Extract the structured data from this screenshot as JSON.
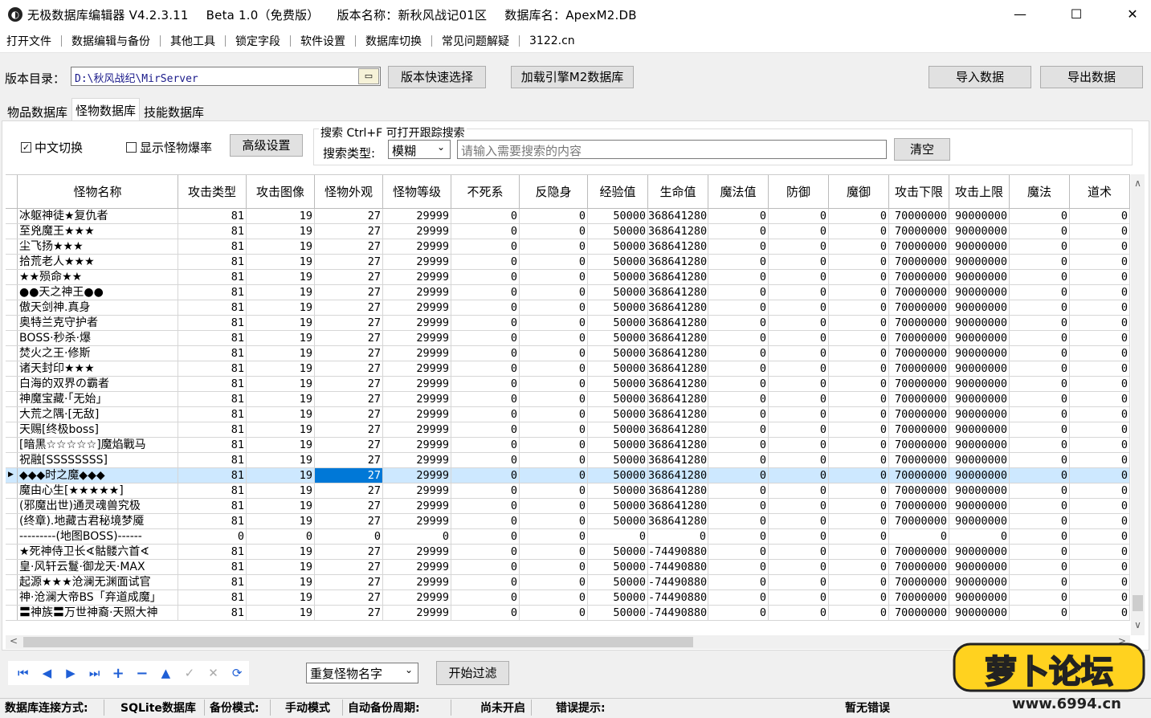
{
  "titlebar": {
    "app": "无极数据库编辑器 V4.2.3.11",
    "edition": "Beta 1.0（免费版）",
    "version_name": "版本名称：新秋风战记01区",
    "db_name": "数据库名：ApexM2.DB",
    "minimize": "—",
    "maximize": "☐",
    "close": "✕"
  },
  "menu": [
    "打开文件",
    "数据编辑与备份",
    "其他工具",
    "锁定字段",
    "软件设置",
    "数据库切换",
    "常见问题解疑",
    "3122.cn"
  ],
  "path": {
    "label": "版本目录：",
    "value": "D:\\秋风战纪\\MirServer",
    "quick_select": "版本快速选择",
    "load_engine": "加载引擎M2数据库",
    "import": "导入数据",
    "export": "导出数据"
  },
  "tabs": [
    "物品数据库",
    "怪物数据库",
    "技能数据库"
  ],
  "options": {
    "chinese_toggle": "中文切换",
    "chinese_checked": true,
    "show_drop": "显示怪物爆率",
    "show_drop_checked": false,
    "advanced": "高级设置"
  },
  "search": {
    "title": "搜索  Ctrl+F 可打开跟踪搜索",
    "type_label": "搜索类型:",
    "type_value": "模糊",
    "placeholder": "请输入需要搜索的内容",
    "clear": "清空"
  },
  "grid": {
    "columns": [
      "怪物名称",
      "攻击类型",
      "攻击图像",
      "怪物外观",
      "怪物等级",
      "不死系",
      "反隐身",
      "经验值",
      "生命值",
      "魔法值",
      "防御",
      "魔御",
      "攻击下限",
      "攻击上限",
      "魔法",
      "道术"
    ],
    "selected_row": 17,
    "rows": [
      [
        "冰躯神徒★复仇者",
        "81",
        "19",
        "27",
        "29999",
        "0",
        "0",
        "50000",
        "368641280",
        "0",
        "0",
        "0",
        "70000000",
        "90000000",
        "0",
        "0"
      ],
      [
        "至兇魔王★★★",
        "81",
        "19",
        "27",
        "29999",
        "0",
        "0",
        "50000",
        "368641280",
        "0",
        "0",
        "0",
        "70000000",
        "90000000",
        "0",
        "0"
      ],
      [
        "尘飞扬★★★",
        "81",
        "19",
        "27",
        "29999",
        "0",
        "0",
        "50000",
        "368641280",
        "0",
        "0",
        "0",
        "70000000",
        "90000000",
        "0",
        "0"
      ],
      [
        "拾荒老人★★★",
        "81",
        "19",
        "27",
        "29999",
        "0",
        "0",
        "50000",
        "368641280",
        "0",
        "0",
        "0",
        "70000000",
        "90000000",
        "0",
        "0"
      ],
      [
        "★★殒命★★",
        "81",
        "19",
        "27",
        "29999",
        "0",
        "0",
        "50000",
        "368641280",
        "0",
        "0",
        "0",
        "70000000",
        "90000000",
        "0",
        "0"
      ],
      [
        "●●天之神王●●",
        "81",
        "19",
        "27",
        "29999",
        "0",
        "0",
        "50000",
        "368641280",
        "0",
        "0",
        "0",
        "70000000",
        "90000000",
        "0",
        "0"
      ],
      [
        "傲天剑神.真身",
        "81",
        "19",
        "27",
        "29999",
        "0",
        "0",
        "50000",
        "368641280",
        "0",
        "0",
        "0",
        "70000000",
        "90000000",
        "0",
        "0"
      ],
      [
        "奥特兰克守护者",
        "81",
        "19",
        "27",
        "29999",
        "0",
        "0",
        "50000",
        "368641280",
        "0",
        "0",
        "0",
        "70000000",
        "90000000",
        "0",
        "0"
      ],
      [
        "BOSS·秒杀·爆",
        "81",
        "19",
        "27",
        "29999",
        "0",
        "0",
        "50000",
        "368641280",
        "0",
        "0",
        "0",
        "70000000",
        "90000000",
        "0",
        "0"
      ],
      [
        "焚火之王·修斯",
        "81",
        "19",
        "27",
        "29999",
        "0",
        "0",
        "50000",
        "368641280",
        "0",
        "0",
        "0",
        "70000000",
        "90000000",
        "0",
        "0"
      ],
      [
        "诸天封印★★★",
        "81",
        "19",
        "27",
        "29999",
        "0",
        "0",
        "50000",
        "368641280",
        "0",
        "0",
        "0",
        "70000000",
        "90000000",
        "0",
        "0"
      ],
      [
        "白海的双界の霸者",
        "81",
        "19",
        "27",
        "29999",
        "0",
        "0",
        "50000",
        "368641280",
        "0",
        "0",
        "0",
        "70000000",
        "90000000",
        "0",
        "0"
      ],
      [
        "神魔宝藏·「无始」",
        "81",
        "19",
        "27",
        "29999",
        "0",
        "0",
        "50000",
        "368641280",
        "0",
        "0",
        "0",
        "70000000",
        "90000000",
        "0",
        "0"
      ],
      [
        "大荒之隅·[无敌]",
        "81",
        "19",
        "27",
        "29999",
        "0",
        "0",
        "50000",
        "368641280",
        "0",
        "0",
        "0",
        "70000000",
        "90000000",
        "0",
        "0"
      ],
      [
        "天赐[终极boss]",
        "81",
        "19",
        "27",
        "29999",
        "0",
        "0",
        "50000",
        "368641280",
        "0",
        "0",
        "0",
        "70000000",
        "90000000",
        "0",
        "0"
      ],
      [
        "[暗黑☆☆☆☆☆]魔焰戰马",
        "81",
        "19",
        "27",
        "29999",
        "0",
        "0",
        "50000",
        "368641280",
        "0",
        "0",
        "0",
        "70000000",
        "90000000",
        "0",
        "0"
      ],
      [
        "祝融[SSSSSSSS]",
        "81",
        "19",
        "27",
        "29999",
        "0",
        "0",
        "50000",
        "368641280",
        "0",
        "0",
        "0",
        "70000000",
        "90000000",
        "0",
        "0"
      ],
      [
        "◆◆◆时之魔◆◆◆",
        "81",
        "19",
        "27",
        "29999",
        "0",
        "0",
        "50000",
        "368641280",
        "0",
        "0",
        "0",
        "70000000",
        "90000000",
        "0",
        "0"
      ],
      [
        "魔由心生[★★★★★]",
        "81",
        "19",
        "27",
        "29999",
        "0",
        "0",
        "50000",
        "368641280",
        "0",
        "0",
        "0",
        "70000000",
        "90000000",
        "0",
        "0"
      ],
      [
        "(邪魔出世)通灵魂兽究极",
        "81",
        "19",
        "27",
        "29999",
        "0",
        "0",
        "50000",
        "368641280",
        "0",
        "0",
        "0",
        "70000000",
        "90000000",
        "0",
        "0"
      ],
      [
        "(终章).地藏古君秘境梦魇",
        "81",
        "19",
        "27",
        "29999",
        "0",
        "0",
        "50000",
        "368641280",
        "0",
        "0",
        "0",
        "70000000",
        "90000000",
        "0",
        "0"
      ],
      [
        "---------(地图BOSS)------",
        "0",
        "0",
        "0",
        "0",
        "0",
        "0",
        "0",
        "0",
        "0",
        "0",
        "0",
        "0",
        "0",
        "0",
        "0"
      ],
      [
        "★死神侍卫长∢骷髅六首∢",
        "81",
        "19",
        "27",
        "29999",
        "0",
        "0",
        "50000",
        "-74490880",
        "0",
        "0",
        "0",
        "70000000",
        "90000000",
        "0",
        "0"
      ],
      [
        "皇·风轩云鬘·御龙天·MAX",
        "81",
        "19",
        "27",
        "29999",
        "0",
        "0",
        "50000",
        "-74490880",
        "0",
        "0",
        "0",
        "70000000",
        "90000000",
        "0",
        "0"
      ],
      [
        "起源★★★沧澜无渊面试官",
        "81",
        "19",
        "27",
        "29999",
        "0",
        "0",
        "50000",
        "-74490880",
        "0",
        "0",
        "0",
        "70000000",
        "90000000",
        "0",
        "0"
      ],
      [
        "神·沧澜大帝BS「弃道成魔」",
        "81",
        "19",
        "27",
        "29999",
        "0",
        "0",
        "50000",
        "-74490880",
        "0",
        "0",
        "0",
        "70000000",
        "90000000",
        "0",
        "0"
      ],
      [
        "〓神族〓万世神裔·天照大神",
        "81",
        "19",
        "27",
        "29999",
        "0",
        "0",
        "50000",
        "-74490880",
        "0",
        "0",
        "0",
        "70000000",
        "90000000",
        "0",
        "0"
      ]
    ]
  },
  "nav": {
    "first": "⏮",
    "prev": "◀",
    "next": "▶",
    "last": "⏭",
    "add": "+",
    "remove": "−",
    "up": "▲",
    "confirm": "✓",
    "cancel": "✕",
    "refresh": "⟳"
  },
  "filter": {
    "select_value": "重复怪物名字",
    "start": "开始过滤"
  },
  "status": {
    "conn_label": "数据库连接方式:",
    "conn_value": "SQLite数据库",
    "backup_label": "备份模式:",
    "backup_value": "手动模式",
    "cycle_label": "自动备份周期:",
    "cycle_value": "尚未开启",
    "error_label": "错误提示:",
    "error_value": "暂无错误"
  },
  "watermark": {
    "brand": "萝卜论坛",
    "url": "www.6994.cn"
  },
  "colors": {
    "selection_row": "#cde8ff",
    "selection_cell": "#0078d7",
    "nav_icon": "#1f5fd6"
  }
}
